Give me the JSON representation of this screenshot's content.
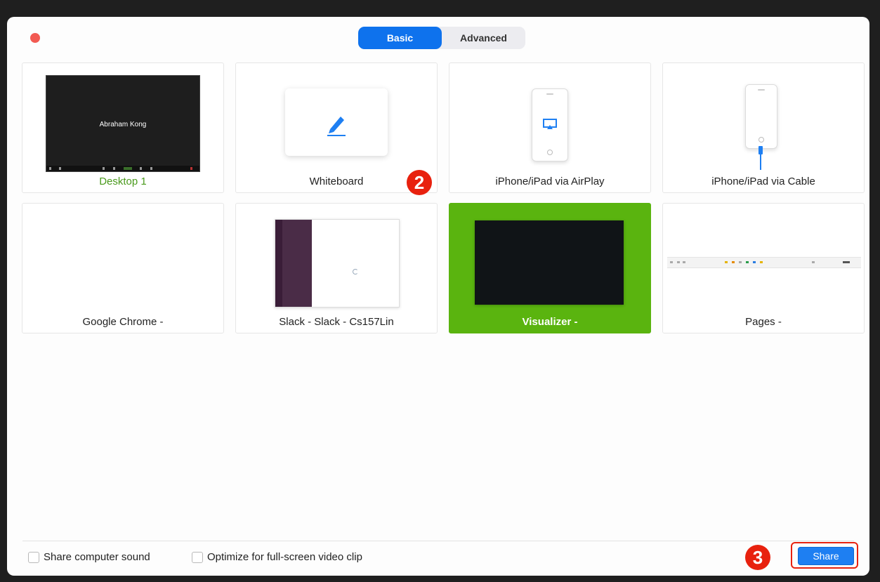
{
  "window": {
    "tabs": [
      {
        "label": "Basic",
        "active": true
      },
      {
        "label": "Advanced",
        "active": false
      }
    ]
  },
  "tiles": [
    {
      "label": "Desktop 1",
      "thumbnail_text": "Abraham Kong"
    },
    {
      "label": "Whiteboard"
    },
    {
      "label": "iPhone/iPad via AirPlay"
    },
    {
      "label": "iPhone/iPad via Cable"
    },
    {
      "label": "Google Chrome -"
    },
    {
      "label": "Slack - Slack - Cs157Lin"
    },
    {
      "label": "Visualizer -",
      "selected": true
    },
    {
      "label": "Pages -"
    }
  ],
  "footer": {
    "share_sound_label": "Share computer sound",
    "optimize_label": "Optimize for full-screen video clip",
    "share_label": "Share"
  },
  "annotations": {
    "step2": "2",
    "step3": "3"
  },
  "colors": {
    "accent_blue": "#0e72ed",
    "selected_green": "#5ab40f",
    "annotation_red": "#e8210e",
    "close_red": "#f25a52"
  },
  "icons": [
    "pen-icon",
    "airplay-icon",
    "lightning-cable-icon",
    "close-icon"
  ]
}
